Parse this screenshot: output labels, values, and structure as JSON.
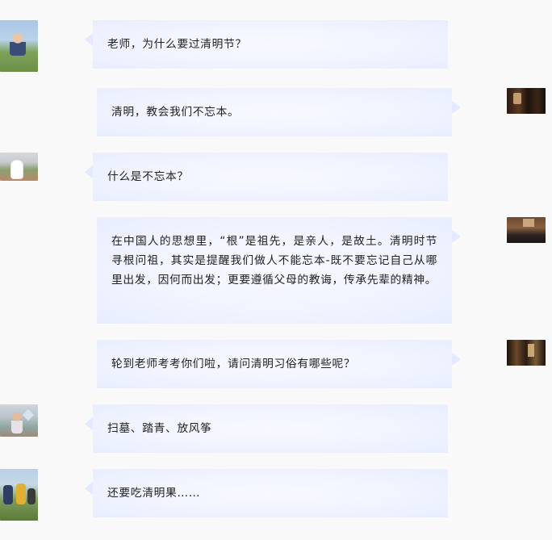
{
  "messages": [
    {
      "side": "left",
      "text": "老师，为什么要过清明节？",
      "avatar_icon": "child-avatar-photo"
    },
    {
      "side": "right",
      "text": "清明，教会我们不忘本。",
      "avatar_icon": "teacher-avatar-photo"
    },
    {
      "side": "left",
      "text": "什么是不忘本？",
      "avatar_icon": "child-avatar-photo"
    },
    {
      "side": "right",
      "text": "在中国人的思想里，“根”是祖先，是亲人，是故土。清明时节寻根问祖，其实是提醒我们做人不能忘本-既不要忘记自己从哪里出发，因何而出发；更要遵循父母的教诲，传承先辈的精神。",
      "avatar_icon": "teacher-avatar-photo"
    },
    {
      "side": "right",
      "text": "轮到老师考考你们啦，请问清明习俗有哪些呢？",
      "avatar_icon": "teacher-avatar-photo"
    },
    {
      "side": "left",
      "text": "扫墓、踏青、放风筝",
      "avatar_icon": "child-avatar-photo"
    },
    {
      "side": "left",
      "text": "还要吃清明果……",
      "avatar_icon": "child-avatar-photo"
    }
  ],
  "colors": {
    "background": "#f9f9fa",
    "bubble_center": "#f8f9ff",
    "bubble_edge": "#e8edff",
    "text": "#222222"
  }
}
